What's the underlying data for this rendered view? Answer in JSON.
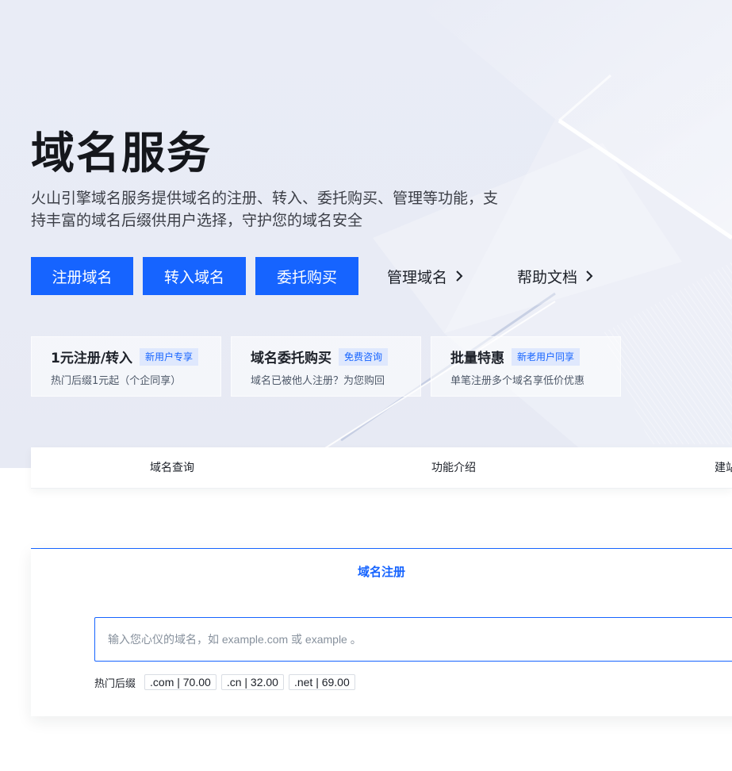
{
  "hero": {
    "title": "域名服务",
    "desc_line1": "火山引擎域名服务提供域名的注册、转入、委托购买、管理等功能，支",
    "desc_line2": "持丰富的域名后缀供用户选择，守护您的域名安全",
    "buttons": [
      "注册域名",
      "转入域名",
      "委托购买"
    ],
    "links": [
      "管理域名",
      "帮助文档"
    ],
    "accent": "#1664ff"
  },
  "cards": [
    {
      "title": "1元注册/转入",
      "badge": "新用户专享",
      "sub": "热门后缀1元起（个企同享）"
    },
    {
      "title": "域名委托购买",
      "badge": "免费咨询",
      "sub": "域名已被他人注册？为您购回"
    },
    {
      "title": "批量特惠",
      "badge": "新老用户同享",
      "sub": "单笔注册多个域名享低价优惠"
    }
  ],
  "tabs": [
    "域名查询",
    "功能介绍",
    "建站"
  ],
  "register": {
    "title": "域名注册",
    "placeholder": "输入您心仪的域名，如 example.com 或 example 。",
    "hot_label": "热门后缀",
    "chips": [
      ".com | 70.00",
      ".cn | 32.00",
      ".net | 69.00"
    ]
  },
  "icons": [
    "chevron-right-icon"
  ]
}
